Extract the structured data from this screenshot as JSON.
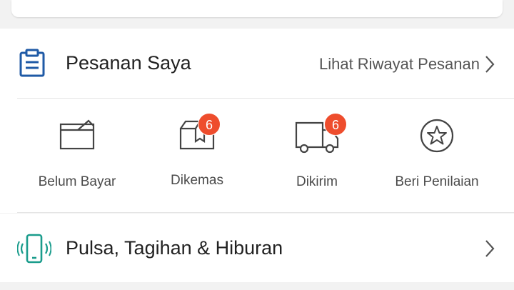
{
  "orders": {
    "title": "Pesanan Saya",
    "history_link": "Lihat Riwayat Pesanan",
    "statuses": [
      {
        "label": "Belum Bayar",
        "icon": "wallet-icon",
        "badge": null
      },
      {
        "label": "Dikemas",
        "icon": "package-icon",
        "badge": "6"
      },
      {
        "label": "Dikirim",
        "icon": "truck-icon",
        "badge": "6"
      },
      {
        "label": "Beri Penilaian",
        "icon": "star-icon",
        "badge": null
      }
    ]
  },
  "bills": {
    "title": "Pulsa, Tagihan & Hiburan",
    "icon": "phone-icon"
  },
  "colors": {
    "badge": "#ee4d2d",
    "clipboard_icon": "#1f5aa6",
    "phone_icon": "#1a9c8c",
    "text_primary": "#222222",
    "text_secondary": "#555555"
  }
}
